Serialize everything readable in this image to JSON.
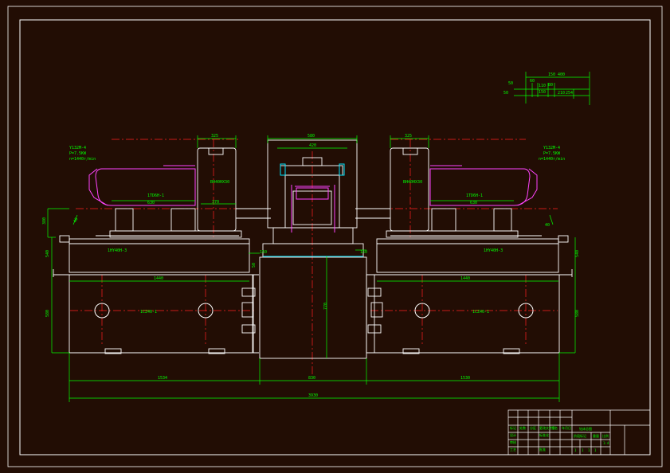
{
  "colors": {
    "background": "#220d04",
    "frame": "#ffffff",
    "outline": "#ffffff",
    "dimension": "#00ff00",
    "centerline": "#ff2020",
    "hidden_parts": "#ff44ff",
    "cyan_parts": "#00e5ff"
  },
  "motor_left": {
    "model": "Y132M-4",
    "power": "P=7.5KW",
    "speed": "n=1440r/min"
  },
  "motor_right": {
    "model": "Y132M-4",
    "power": "P=7.5KW",
    "speed": "n=1440r/min"
  },
  "head_labels": {
    "left": "1TD6H-1",
    "right": "1TD6H-1",
    "left_dim": "630",
    "right_dim": "630",
    "box_left": "BH40HX30",
    "box_right": "BH40HX30"
  },
  "slide_labels": {
    "left": "1HY40H-3",
    "right": "1HY40H-3"
  },
  "base_labels": {
    "left": "1CZ40-1",
    "right": "1CZ40-1"
  },
  "dimensions": {
    "top_325_left": "325",
    "top_325_right": "325",
    "fixture_width": "580",
    "fixture_inner": "420",
    "side_left_top": "380",
    "side_left_mid": "540",
    "side_left_low": "580",
    "side_right_mid": "540",
    "side_right_low": "580",
    "rail_left": "1440",
    "rail_right": "1440",
    "bottom_left": "1534",
    "bottom_center": "830",
    "bottom_right": "1530",
    "overall": "3930",
    "center_height": "770",
    "inner_370": "370",
    "small_40_left": "40",
    "small_40_right": "40",
    "small_50": "50",
    "small_150_left": "150",
    "small_150_right": "150"
  },
  "legend_dims": {
    "top": "150 400",
    "d1": "110",
    "d2": "60",
    "d3": "80",
    "d4": "150",
    "d5": "254",
    "d6": "210",
    "side": "50",
    "label": "50"
  },
  "title_block": {
    "title": "钻床总图",
    "row_a": [
      "标记",
      "处数",
      "分区",
      "更改文件号",
      "签名",
      "年月日"
    ],
    "row_b": [
      "设计",
      "",
      "",
      "标准化",
      "",
      ""
    ],
    "row_c": [
      "审核",
      "",
      "",
      "",
      "",
      ""
    ],
    "row_d": [
      "工艺",
      "",
      "",
      "批准",
      "",
      ""
    ],
    "stage_headers": [
      "阶段标记",
      "重量",
      "比例"
    ],
    "scale_row": [
      "1",
      "1",
      "1",
      "1"
    ],
    "sheet": "1:4"
  }
}
